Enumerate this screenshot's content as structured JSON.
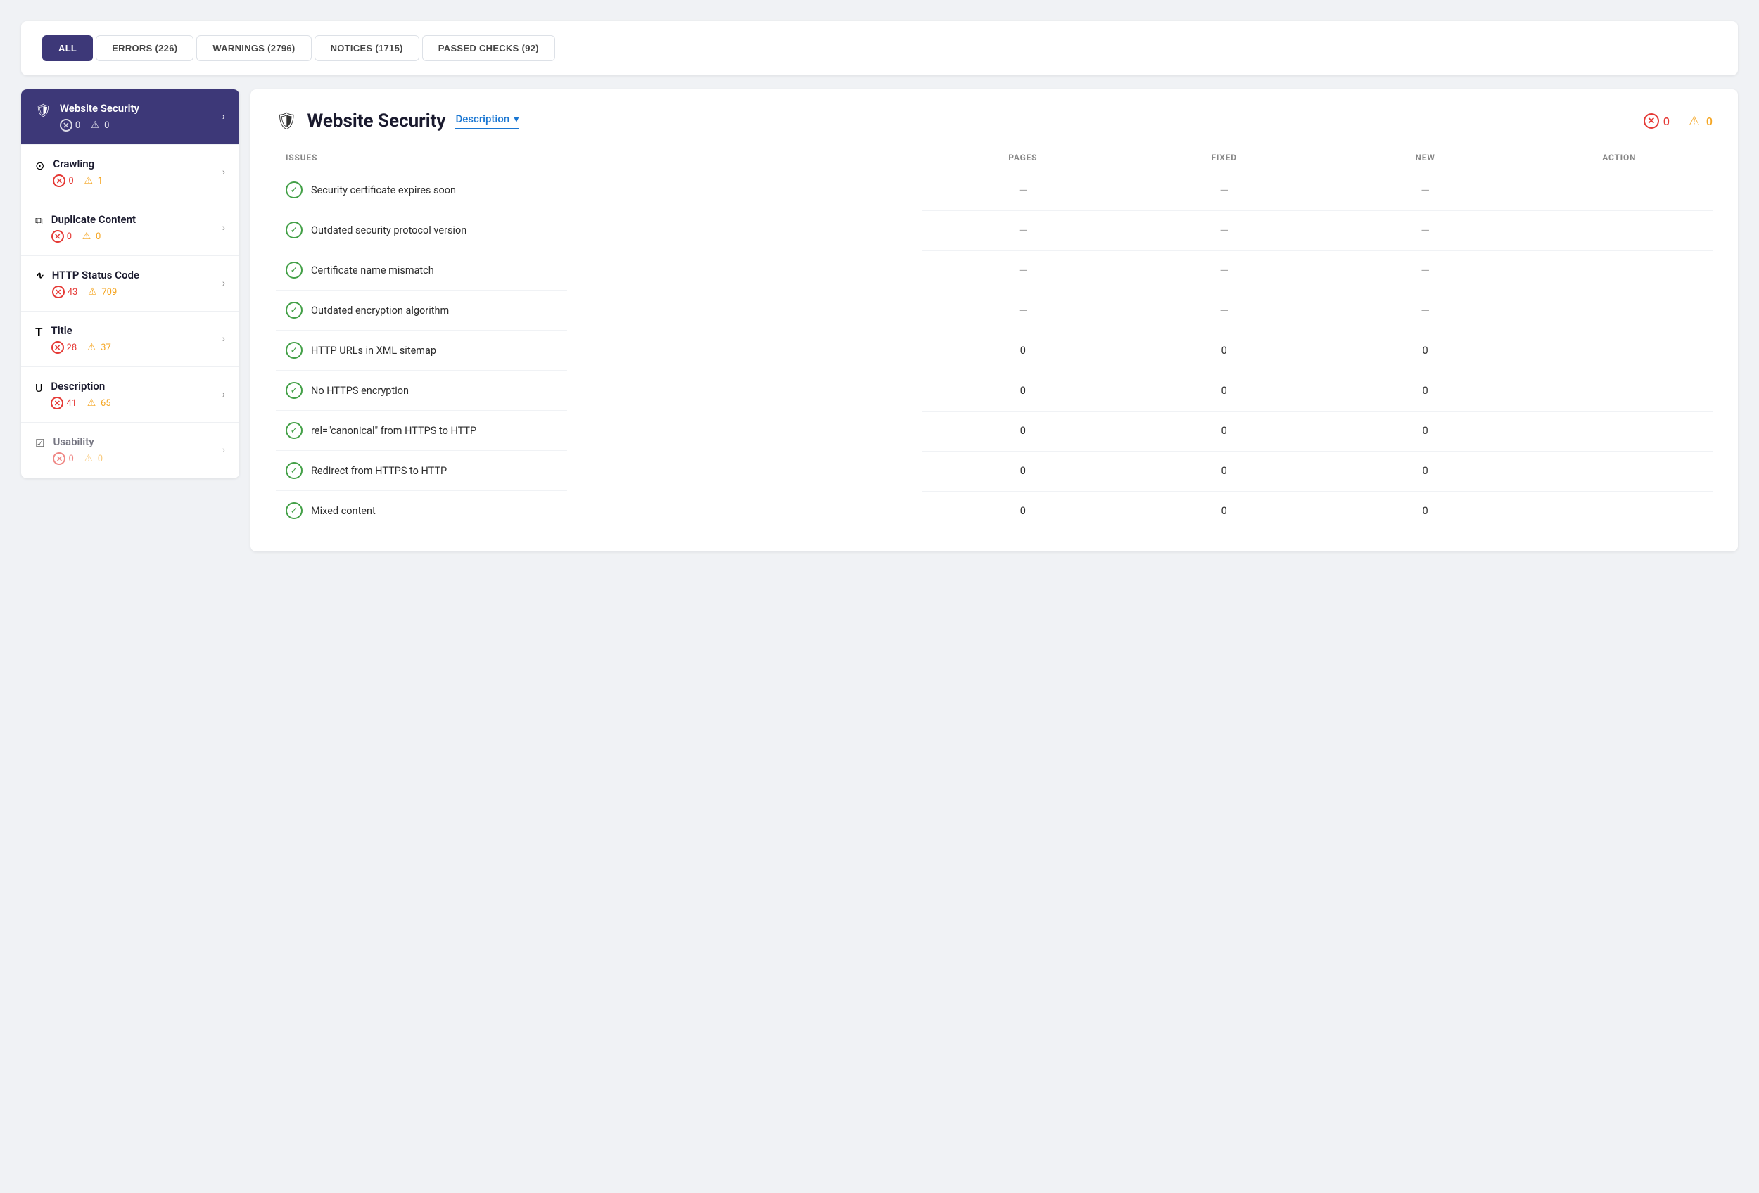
{
  "tabs": [
    {
      "id": "all",
      "label": "ALL",
      "active": true
    },
    {
      "id": "errors",
      "label": "ERRORS (226)",
      "active": false
    },
    {
      "id": "warnings",
      "label": "WARNINGS (2796)",
      "active": false
    },
    {
      "id": "notices",
      "label": "NOTICES (1715)",
      "active": false
    },
    {
      "id": "passed",
      "label": "PASSED CHECKS (92)",
      "active": false
    }
  ],
  "sidebar": {
    "items": [
      {
        "id": "website-security",
        "icon": "🛡",
        "title": "Website Security",
        "errors": "0",
        "warnings": "0",
        "active": true
      },
      {
        "id": "crawling",
        "icon": "🔍",
        "title": "Crawling",
        "errors": "0",
        "warnings": "1",
        "active": false
      },
      {
        "id": "duplicate-content",
        "icon": "⧉",
        "title": "Duplicate Content",
        "errors": "0",
        "warnings": "0",
        "active": false
      },
      {
        "id": "http-status-code",
        "icon": "〜",
        "title": "HTTP Status Code",
        "errors": "43",
        "warnings": "709",
        "active": false
      },
      {
        "id": "title",
        "icon": "T",
        "title": "Title",
        "errors": "28",
        "warnings": "37",
        "active": false
      },
      {
        "id": "description",
        "icon": "U",
        "title": "Description",
        "errors": "41",
        "warnings": "65",
        "active": false
      },
      {
        "id": "usability",
        "icon": "☑",
        "title": "Usability",
        "errors": "0",
        "warnings": "0",
        "active": false,
        "disabled": true
      }
    ]
  },
  "panel": {
    "title": "Website Security",
    "description_label": "Description",
    "error_count": "0",
    "warning_count": "0",
    "table": {
      "columns": [
        "ISSUES",
        "PAGES",
        "FIXED",
        "NEW",
        "ACTION"
      ],
      "rows": [
        {
          "status": "pass",
          "issue": "Security certificate expires soon",
          "pages": "—",
          "fixed": "—",
          "new": "—"
        },
        {
          "status": "pass",
          "issue": "Outdated security protocol version",
          "pages": "—",
          "fixed": "—",
          "new": "—"
        },
        {
          "status": "pass",
          "issue": "Certificate name mismatch",
          "pages": "—",
          "fixed": "—",
          "new": "—"
        },
        {
          "status": "pass",
          "issue": "Outdated encryption algorithm",
          "pages": "—",
          "fixed": "—",
          "new": "—"
        },
        {
          "status": "pass",
          "issue": "HTTP URLs in XML sitemap",
          "pages": "0",
          "fixed": "0",
          "new": "0"
        },
        {
          "status": "pass",
          "issue": "No HTTPS encryption",
          "pages": "0",
          "fixed": "0",
          "new": "0"
        },
        {
          "status": "pass",
          "issue": "rel=\"canonical\" from HTTPS to HTTP",
          "pages": "0",
          "fixed": "0",
          "new": "0"
        },
        {
          "status": "pass",
          "issue": "Redirect from HTTPS to HTTP",
          "pages": "0",
          "fixed": "0",
          "new": "0"
        },
        {
          "status": "pass",
          "issue": "Mixed content",
          "pages": "0",
          "fixed": "0",
          "new": "0"
        }
      ]
    }
  },
  "colors": {
    "sidebar_active_bg": "#3d3878",
    "accent_blue": "#1976d2",
    "error_red": "#e53935",
    "warning_orange": "#f5a623",
    "pass_green": "#43a047"
  }
}
